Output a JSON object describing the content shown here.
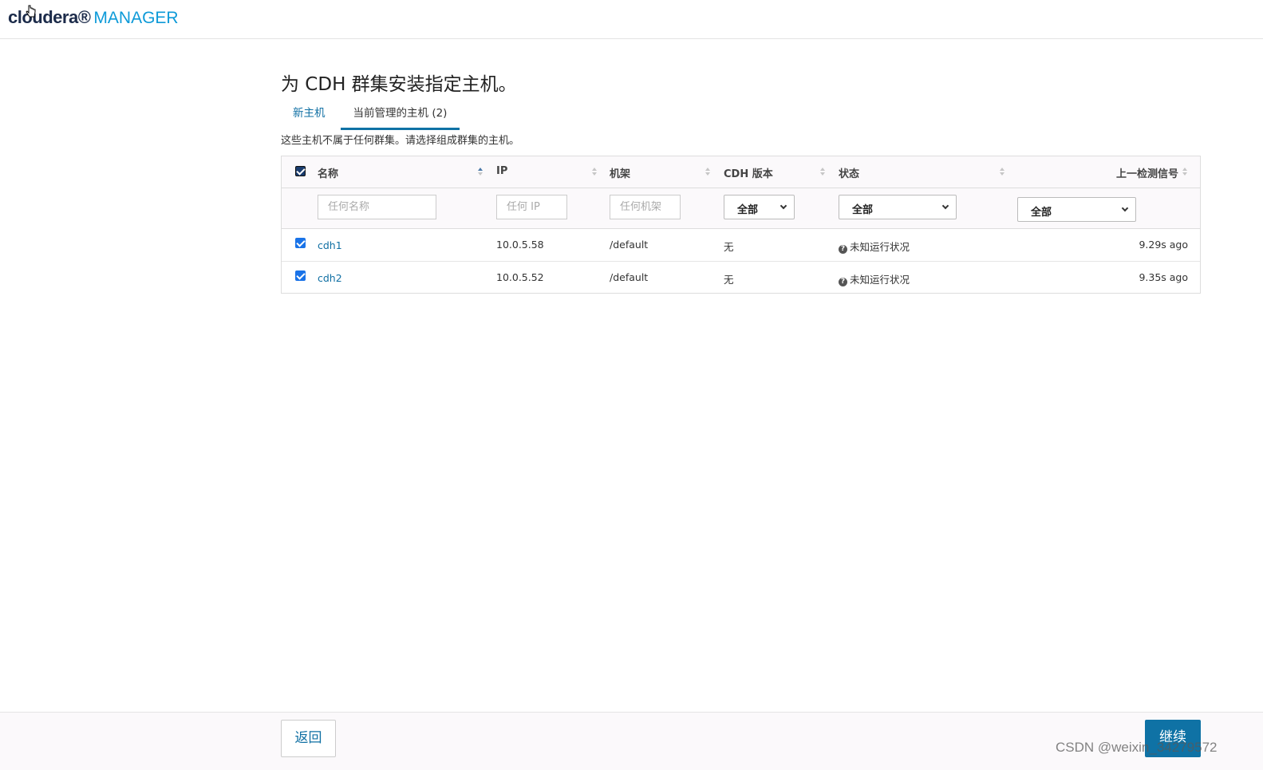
{
  "header": {
    "brand": "cloudera",
    "product": "MANAGER"
  },
  "page": {
    "title": "为 CDH 群集安装指定主机。",
    "subtitle": "这些主机不属于任何群集。请选择组成群集的主机。"
  },
  "tabs": [
    {
      "label": "新主机",
      "active": false
    },
    {
      "label": "当前管理的主机 (2)",
      "active": true
    }
  ],
  "table": {
    "columns": [
      "名称",
      "IP",
      "机架",
      "CDH 版本",
      "状态",
      "上一检测信号"
    ],
    "filters": {
      "name_placeholder": "任何名称",
      "ip_placeholder": "任何 IP",
      "rack_placeholder": "任何机架",
      "cdh_version": "全部",
      "status": "全部",
      "heartbeat": "全部"
    },
    "rows": [
      {
        "checked": true,
        "name": "cdh1",
        "ip": "10.0.5.58",
        "rack": "/default",
        "cdh": "无",
        "status": "未知运行状况",
        "heartbeat": "9.29s ago"
      },
      {
        "checked": true,
        "name": "cdh2",
        "ip": "10.0.5.52",
        "rack": "/default",
        "cdh": "无",
        "status": "未知运行状况",
        "heartbeat": "9.35s ago"
      }
    ]
  },
  "footer": {
    "back_label": "返回",
    "continue_label": "继续",
    "watermark": "CSDN @weixin_34279572"
  },
  "colors": {
    "accent": "#0f72a5",
    "link": "#0f6fa3",
    "brand_dark": "#1c2b4a",
    "brand_light": "#0d9ad8"
  },
  "icons": {
    "status_unknown": "question-circle-icon",
    "sort": "sort-arrows-icon",
    "select": "chevron-down-icon",
    "cursor": "hand-pointer-icon"
  }
}
